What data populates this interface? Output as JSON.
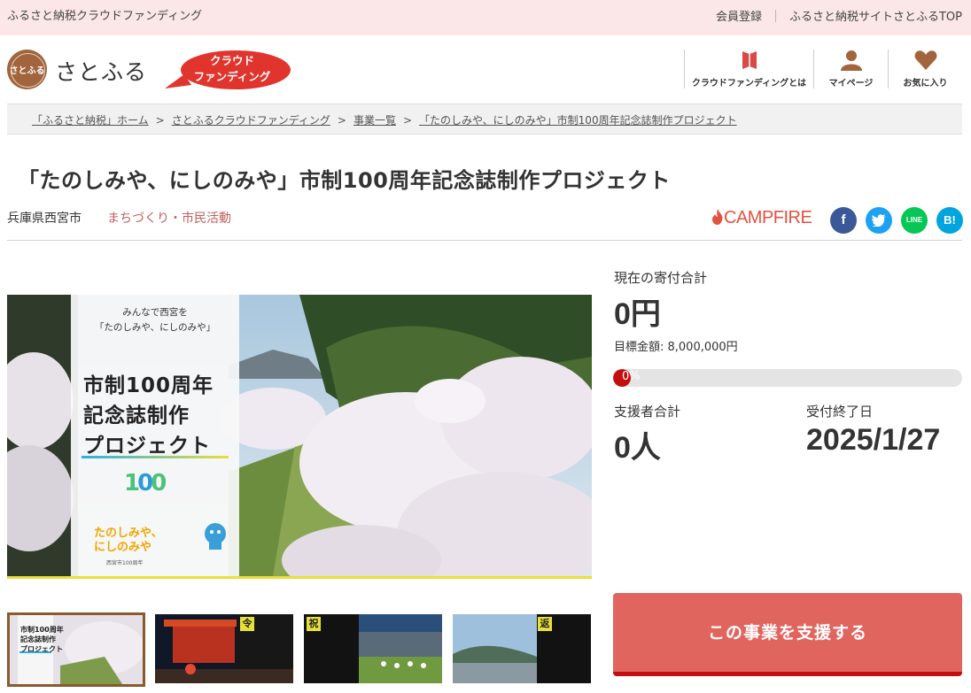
{
  "topbar": {
    "site_name": "ふるさと納税クラウドファンディング",
    "links": [
      "会員登録",
      "ふるさと納税サイトさとふるTOP"
    ]
  },
  "header": {
    "logo_mark": "さとふる",
    "logo_text": "さとふる",
    "badge_lines": [
      "クラウド",
      "ファンディング"
    ],
    "nav": [
      {
        "label": "クラウドファンディングとは",
        "icon": "bookmark-icon"
      },
      {
        "label": "マイページ",
        "icon": "user-icon"
      },
      {
        "label": "お気に入り",
        "icon": "heart-icon"
      }
    ]
  },
  "breadcrumb": [
    "「ふるさと納税」ホーム",
    "さとふるクラウドファンディング",
    "事業一覧",
    "「たのしみや、にしのみや」市制100周年記念誌制作プロジェクト"
  ],
  "project": {
    "title": "「たのしみや、にしのみや」市制100周年記念誌制作プロジェクト",
    "location": "兵庫県西宮市",
    "category": "まちづくり・市民活動",
    "partner": "CAMPFIRE"
  },
  "social": [
    {
      "name": "facebook",
      "glyph": "f"
    },
    {
      "name": "twitter",
      "glyph": "t"
    },
    {
      "name": "line",
      "glyph": "LINE"
    },
    {
      "name": "hatena",
      "glyph": "B!"
    }
  ],
  "poster": {
    "subtitle_lines": [
      "みんなで西宮を",
      "「たのしみや、にしのみや」"
    ],
    "main_lines": [
      "市制100周年",
      "記念誌制作",
      "プロジェクト"
    ],
    "mascot_lines": [
      "たのしみや、",
      "にしのみや"
    ],
    "mascot_sub": "西宮市100周年"
  },
  "thumbnails": [
    {
      "marker": "",
      "active": true
    },
    {
      "marker": "令",
      "active": false
    },
    {
      "marker": "祝",
      "active": false
    },
    {
      "marker": "返",
      "active": false
    }
  ],
  "stats": {
    "total_label": "現在の寄付合計",
    "total_value": "0円",
    "goal_text": "目標金額: 8,000,000円",
    "progress_percent": 0,
    "progress_text": "0%",
    "supporters_label": "支援者合計",
    "supporters_value": "0人",
    "deadline_label": "受付終了日",
    "deadline_value": "2025/1/27"
  },
  "cta_label": "この事業を支援する",
  "colors": {
    "topbar_bg": "#fbe7e7",
    "brand_brown": "#a2643c",
    "accent_red": "#c40f0f",
    "cta_bg": "#e0655f",
    "category_text": "#c0605e"
  }
}
